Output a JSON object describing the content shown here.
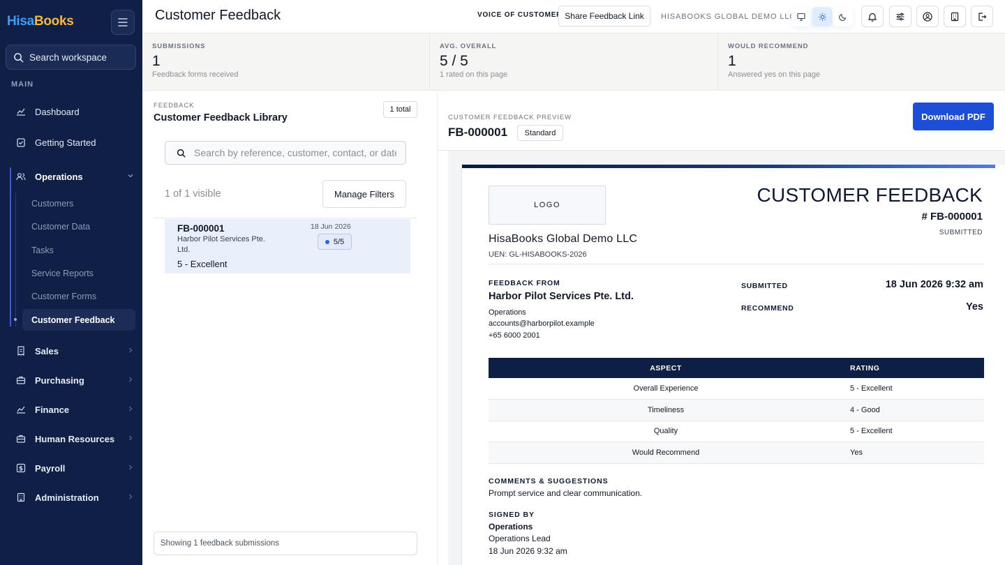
{
  "app": {
    "logo_part1": "Hisa",
    "logo_part2": "Books",
    "search_placeholder": "Search workspace",
    "section_label": "MAIN"
  },
  "sidebar": {
    "items": [
      {
        "label": "Dashboard",
        "icon": "chart-line-icon"
      },
      {
        "label": "Getting Started",
        "icon": "checklist-icon"
      },
      {
        "label": "Operations",
        "icon": "users-icon",
        "expanded": true
      },
      {
        "label": "Sales",
        "icon": "receipt-icon"
      },
      {
        "label": "Purchasing",
        "icon": "briefcase-icon"
      },
      {
        "label": "Finance",
        "icon": "chart-line-icon"
      },
      {
        "label": "Human Resources",
        "icon": "briefcase-icon"
      },
      {
        "label": "Payroll",
        "icon": "dollar-icon"
      },
      {
        "label": "Administration",
        "icon": "building-icon"
      }
    ],
    "operations_sub": [
      "Customers",
      "Customer Data",
      "Tasks",
      "Service Reports",
      "Customer Forms",
      "Customer Feedback"
    ]
  },
  "header": {
    "title": "Customer Feedback",
    "kicker": "VOICE OF CUSTOMER",
    "share_label": "Share Feedback Link",
    "company": "HISABOOKS GLOBAL DEMO LLC"
  },
  "stats": [
    {
      "label": "SUBMISSIONS",
      "value": "1",
      "sub": "Feedback forms received"
    },
    {
      "label": "AVG. OVERALL",
      "value": "5 / 5",
      "sub": "1 rated on this page"
    },
    {
      "label": "WOULD RECOMMEND",
      "value": "1",
      "sub": "Answered yes on this page"
    }
  ],
  "library": {
    "kicker": "FEEDBACK",
    "title": "Customer Feedback Library",
    "total": "1 total",
    "search_placeholder": "Search by reference, customer, contact, or date",
    "visible": "1 of 1 visible",
    "filters_label": "Manage Filters",
    "rows": [
      {
        "ref": "FB-000001",
        "customer": "Harbor Pilot Services Pte. Ltd.",
        "score": "5 - Excellent",
        "date": "18 Jun 2026",
        "rating": "5/5"
      }
    ],
    "footer": "Showing 1 feedback submissions"
  },
  "preview": {
    "kicker": "CUSTOMER FEEDBACK PREVIEW",
    "ref": "FB-000001",
    "badge": "Standard",
    "download_label": "Download PDF",
    "doc": {
      "logo": "LOGO",
      "heading": "CUSTOMER FEEDBACK",
      "number": "# FB-000001",
      "status": "SUBMITTED",
      "company": "HisaBooks Global Demo LLC",
      "uen": "UEN: GL-HISABOOKS-2026",
      "from_label": "FEEDBACK FROM",
      "from_name": "Harbor Pilot Services Pte. Ltd.",
      "from_dept": "Operations",
      "from_email": "accounts@harborpilot.example",
      "from_phone": "+65 6000 2001",
      "submitted_label": "SUBMITTED",
      "submitted_value": "18 Jun 2026 9:32 am",
      "recommend_label": "RECOMMEND",
      "recommend_value": "Yes",
      "table_headers": [
        "ASPECT",
        "RATING"
      ],
      "table_rows": [
        [
          "Overall Experience",
          "5 - Excellent"
        ],
        [
          "Timeliness",
          "4 - Good"
        ],
        [
          "Quality",
          "5 - Excellent"
        ],
        [
          "Would Recommend",
          "Yes"
        ]
      ],
      "comments_label": "COMMENTS & SUGGESTIONS",
      "comments": "Prompt service and clear communication.",
      "signed_label": "SIGNED BY",
      "signed_name": "Operations",
      "signed_role": "Operations Lead",
      "signed_date": "18 Jun 2026 9:32 am"
    }
  }
}
